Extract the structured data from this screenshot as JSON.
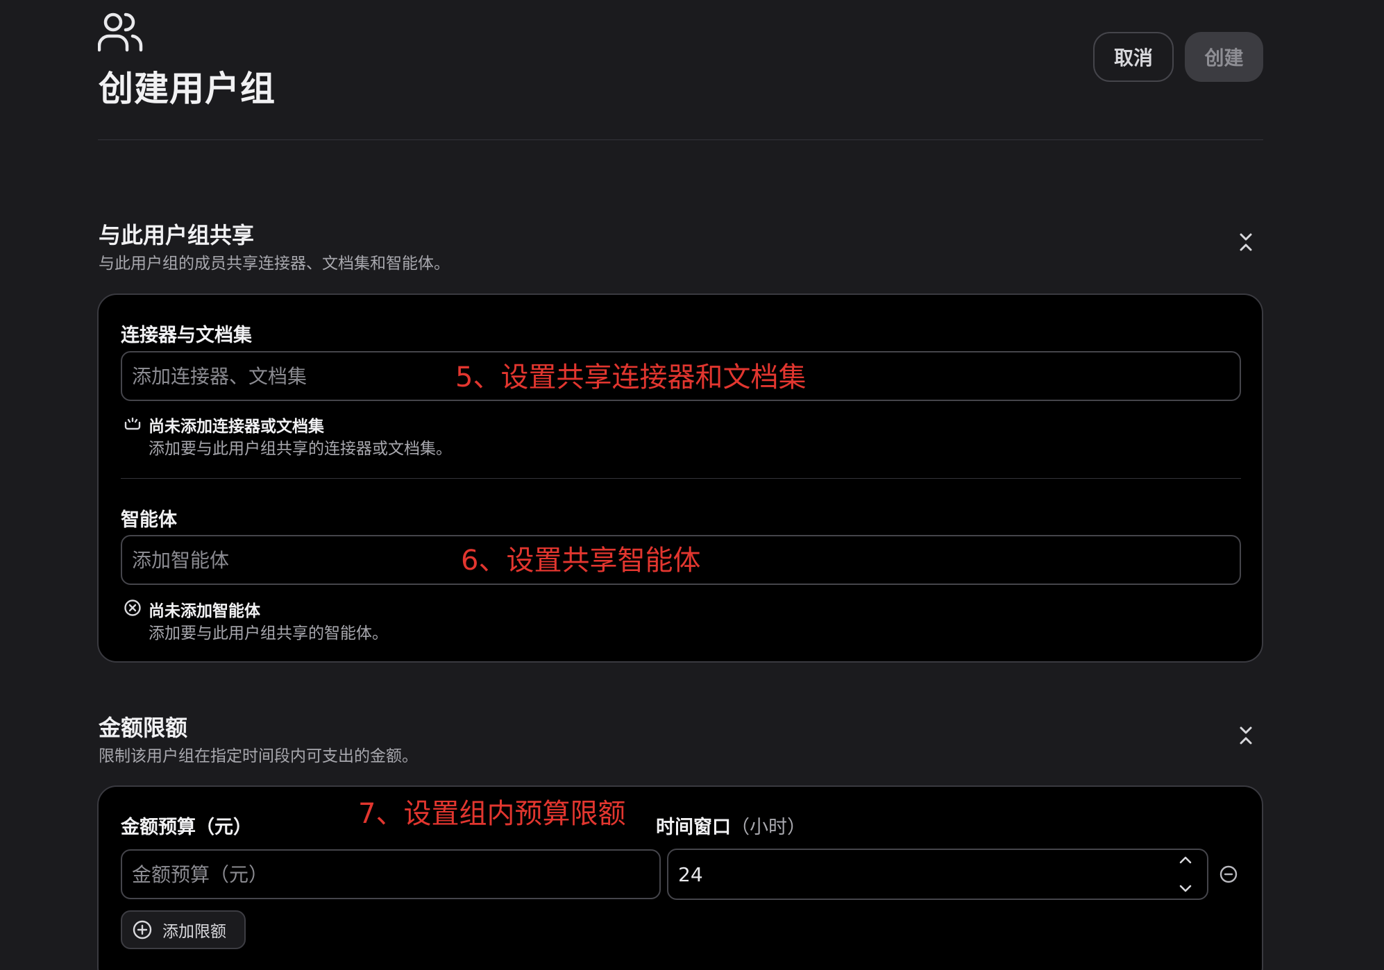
{
  "header": {
    "title": "创建用户组",
    "icon": "users-icon",
    "cancel_label": "取消",
    "create_label": "创建"
  },
  "share_section": {
    "title": "与此用户组共享",
    "description": "与此用户组的成员共享连接器、文档集和智能体。",
    "collapse_icon": "chevrons-collapse-icon",
    "connectors": {
      "label": "连接器与文档集",
      "placeholder": "添加连接器、文档集",
      "value": "",
      "empty_icon": "unplug-icon",
      "empty_title": "尚未添加连接器或文档集",
      "empty_desc": "添加要与此用户组共享的连接器或文档集。",
      "annotation": "5、设置共享连接器和文档集"
    },
    "agents": {
      "label": "智能体",
      "placeholder": "添加智能体",
      "value": "",
      "empty_icon": "circle-x-icon",
      "empty_title": "尚未添加智能体",
      "empty_desc": "添加要与此用户组共享的智能体。",
      "annotation": "6、设置共享智能体"
    }
  },
  "limit_section": {
    "title": "金额限额",
    "description": "限制该用户组在指定时间段内可支出的金额。",
    "collapse_icon": "chevrons-collapse-icon",
    "annotation": "7、设置组内预算限额",
    "budget": {
      "label": "金额预算（元）",
      "placeholder": "金额预算（元）",
      "value": ""
    },
    "window": {
      "label": "时间窗口",
      "unit": "（小时）",
      "value": "24"
    },
    "remove_icon": "circle-minus-icon",
    "add_limit_label": "添加限额",
    "add_icon": "circle-plus-icon"
  },
  "colors": {
    "background": "#1b1b1e",
    "card": "#000000",
    "annotation": "#e2362f",
    "muted_text": "#a8a8ae"
  }
}
